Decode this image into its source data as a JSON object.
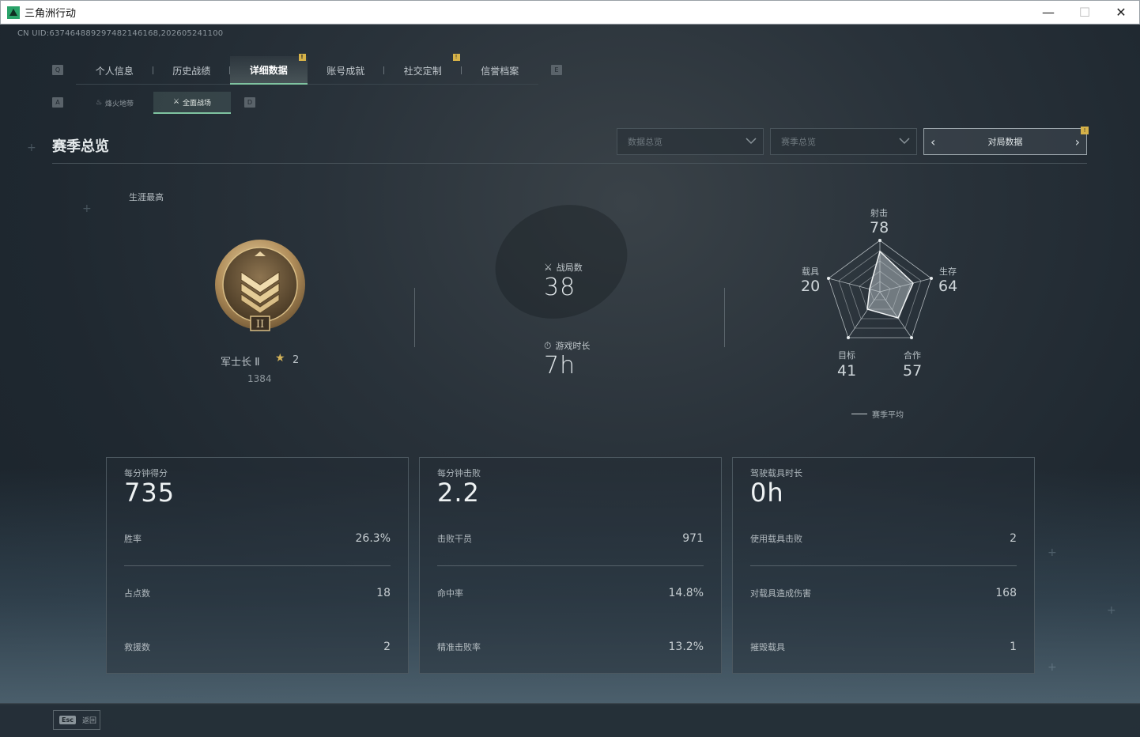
{
  "window": {
    "title": "三角洲行动",
    "minimize": "—",
    "maximize": "☐",
    "close": "✕"
  },
  "uid": "CN UID:6374648892974821461​68,202605241100",
  "nav": {
    "left_key": "Q",
    "right_key": "E",
    "tabs": [
      {
        "label": "个人信息"
      },
      {
        "label": "历史战绩"
      },
      {
        "label": "详细数据"
      },
      {
        "label": "账号成就"
      },
      {
        "label": "社交定制"
      },
      {
        "label": "信誉档案"
      }
    ],
    "notif_mark": "!"
  },
  "subnav": {
    "left_key": "A",
    "right_key": "D",
    "tabs": [
      {
        "label": "烽火地带"
      },
      {
        "label": "全面战场"
      }
    ]
  },
  "section": {
    "title": "赛季总览",
    "dropdowns": [
      {
        "value": "数据总览"
      },
      {
        "value": "赛季总览"
      }
    ],
    "pager_label": "对局数据"
  },
  "career": {
    "label": "生涯最高",
    "rank_name": "军士长 Ⅱ",
    "star_count": "2",
    "score": "1384",
    "medal_numeral": "II"
  },
  "center_stats": {
    "matches_label": "战局数",
    "matches_value": "38",
    "playtime_label": "游戏时长",
    "playtime_value": "7h"
  },
  "radar": {
    "labels": {
      "shoot": "射击",
      "survive": "生存",
      "coop": "合作",
      "target": "目标",
      "vehicle": "载具"
    },
    "values": {
      "shoot": "78",
      "survive": "64",
      "coop": "57",
      "target": "41",
      "vehicle": "20"
    },
    "legend": "赛季平均"
  },
  "cards": [
    {
      "caption": "每分钟得分",
      "big": "735",
      "rows": [
        {
          "label": "胜率",
          "value": "26.3%"
        },
        {
          "label": "占点数",
          "value": "18"
        },
        {
          "label": "救援数",
          "value": "2"
        }
      ]
    },
    {
      "caption": "每分钟击败",
      "big": "2.2",
      "rows": [
        {
          "label": "击败干员",
          "value": "971"
        },
        {
          "label": "命中率",
          "value": "14.8%"
        },
        {
          "label": "精准击败率",
          "value": "13.2%"
        }
      ]
    },
    {
      "caption": "驾驶载具时长",
      "big": "0h",
      "rows": [
        {
          "label": "使用载具击败",
          "value": "2"
        },
        {
          "label": "对载具造成伤害",
          "value": "168"
        },
        {
          "label": "摧毁载具",
          "value": "1"
        }
      ]
    }
  ],
  "footer": {
    "esc_key": "Esc",
    "back_label": "返回"
  }
}
